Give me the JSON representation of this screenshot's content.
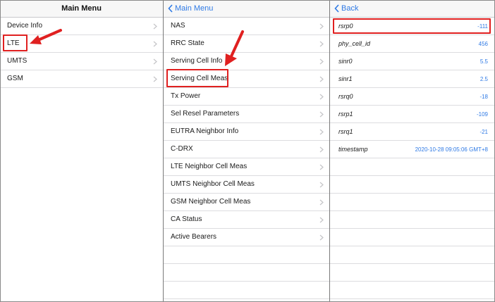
{
  "panel1": {
    "title": "Main Menu",
    "items": [
      {
        "label": "Device Info"
      },
      {
        "label": "LTE"
      },
      {
        "label": "UMTS"
      },
      {
        "label": "GSM"
      }
    ]
  },
  "panel2": {
    "back_label": "Main Menu",
    "items": [
      {
        "label": "NAS"
      },
      {
        "label": "RRC State"
      },
      {
        "label": "Serving Cell Info"
      },
      {
        "label": "Serving Cell Meas"
      },
      {
        "label": "Tx Power"
      },
      {
        "label": "Sel Resel Parameters"
      },
      {
        "label": "EUTRA Neighbor Info"
      },
      {
        "label": "C-DRX"
      },
      {
        "label": "LTE Neighbor Cell Meas"
      },
      {
        "label": "UMTS Neighbor Cell Meas"
      },
      {
        "label": "GSM Neighbor Cell Meas"
      },
      {
        "label": "CA Status"
      },
      {
        "label": "Active Bearers"
      }
    ]
  },
  "panel3": {
    "back_label": "Back",
    "rows": [
      {
        "label": "rsrp0",
        "value": "-111"
      },
      {
        "label": "phy_cell_id",
        "value": "456"
      },
      {
        "label": "sinr0",
        "value": "5.5"
      },
      {
        "label": "sinr1",
        "value": "2.5"
      },
      {
        "label": "rsrq0",
        "value": "-18"
      },
      {
        "label": "rsrp1",
        "value": "-109"
      },
      {
        "label": "rsrq1",
        "value": "-21"
      },
      {
        "label": "timestamp",
        "value": "2020-10-28 09:05:06 GMT+8"
      }
    ]
  },
  "colors": {
    "accent": "#2f7ae5",
    "highlight": "#e02020",
    "separator": "#dcdcdf"
  }
}
